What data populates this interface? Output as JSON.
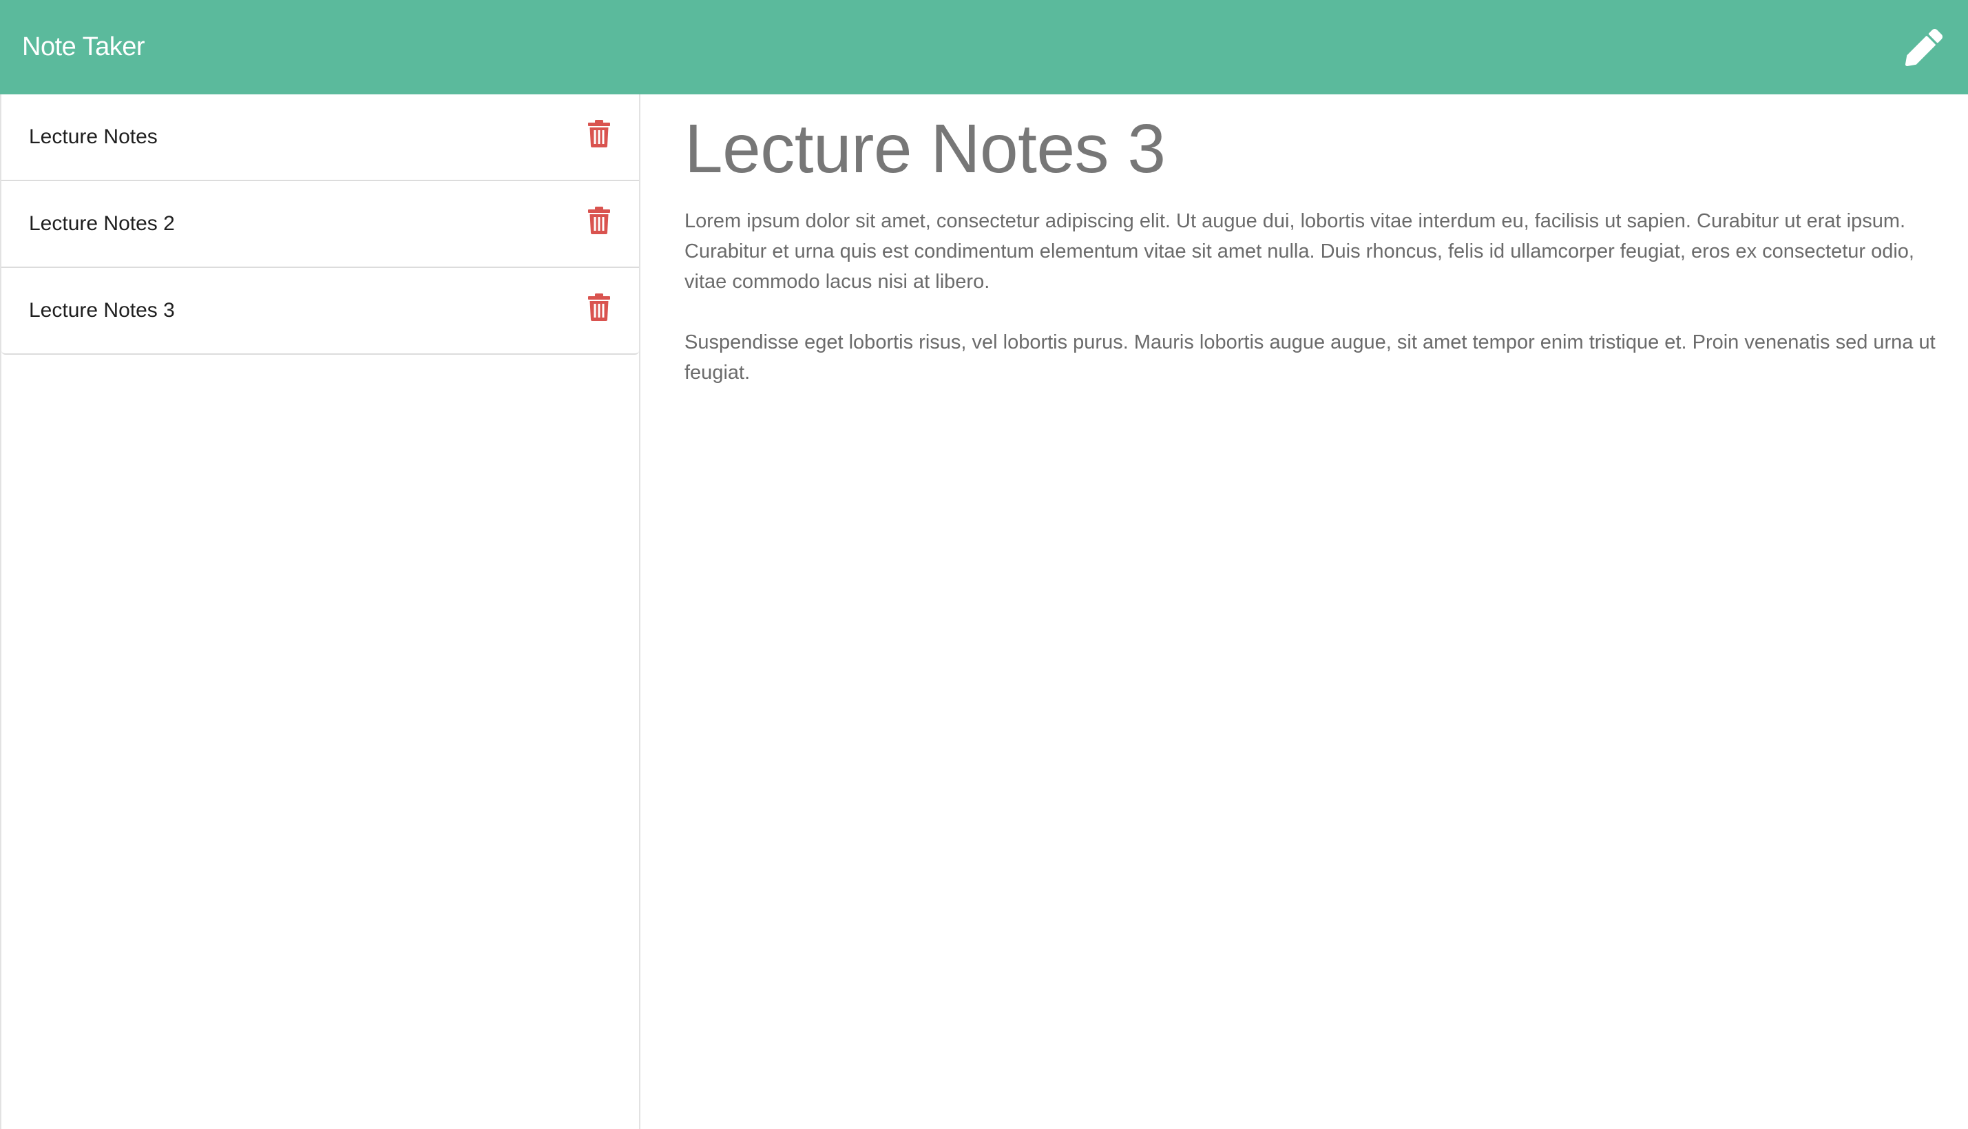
{
  "navbar": {
    "brand": "Note Taker",
    "new_note_icon": "pencil-icon",
    "color": "#5bba9c"
  },
  "sidebar": {
    "notes": [
      {
        "title": "Lecture Notes",
        "delete_icon": "trash-icon"
      },
      {
        "title": "Lecture Notes 2",
        "delete_icon": "trash-icon"
      },
      {
        "title": "Lecture Notes 3",
        "delete_icon": "trash-icon"
      }
    ],
    "delete_color": "#d9534f"
  },
  "active_note": {
    "title": "Lecture Notes 3",
    "body": "Lorem ipsum dolor sit amet, consectetur adipiscing elit. Ut augue dui, lobortis vitae interdum eu, facilisis ut sapien. Curabitur ut erat ipsum. Curabitur et urna quis est condimentum elementum vitae sit amet nulla. Duis rhoncus, felis id ullamcorper feugiat, eros ex consectetur odio, vitae commodo lacus nisi at libero.\n\nSuspendisse eget lobortis risus, vel lobortis purus. Mauris lobortis augue augue, sit amet tempor enim tristique et. Proin venenatis sed urna ut feugiat."
  }
}
